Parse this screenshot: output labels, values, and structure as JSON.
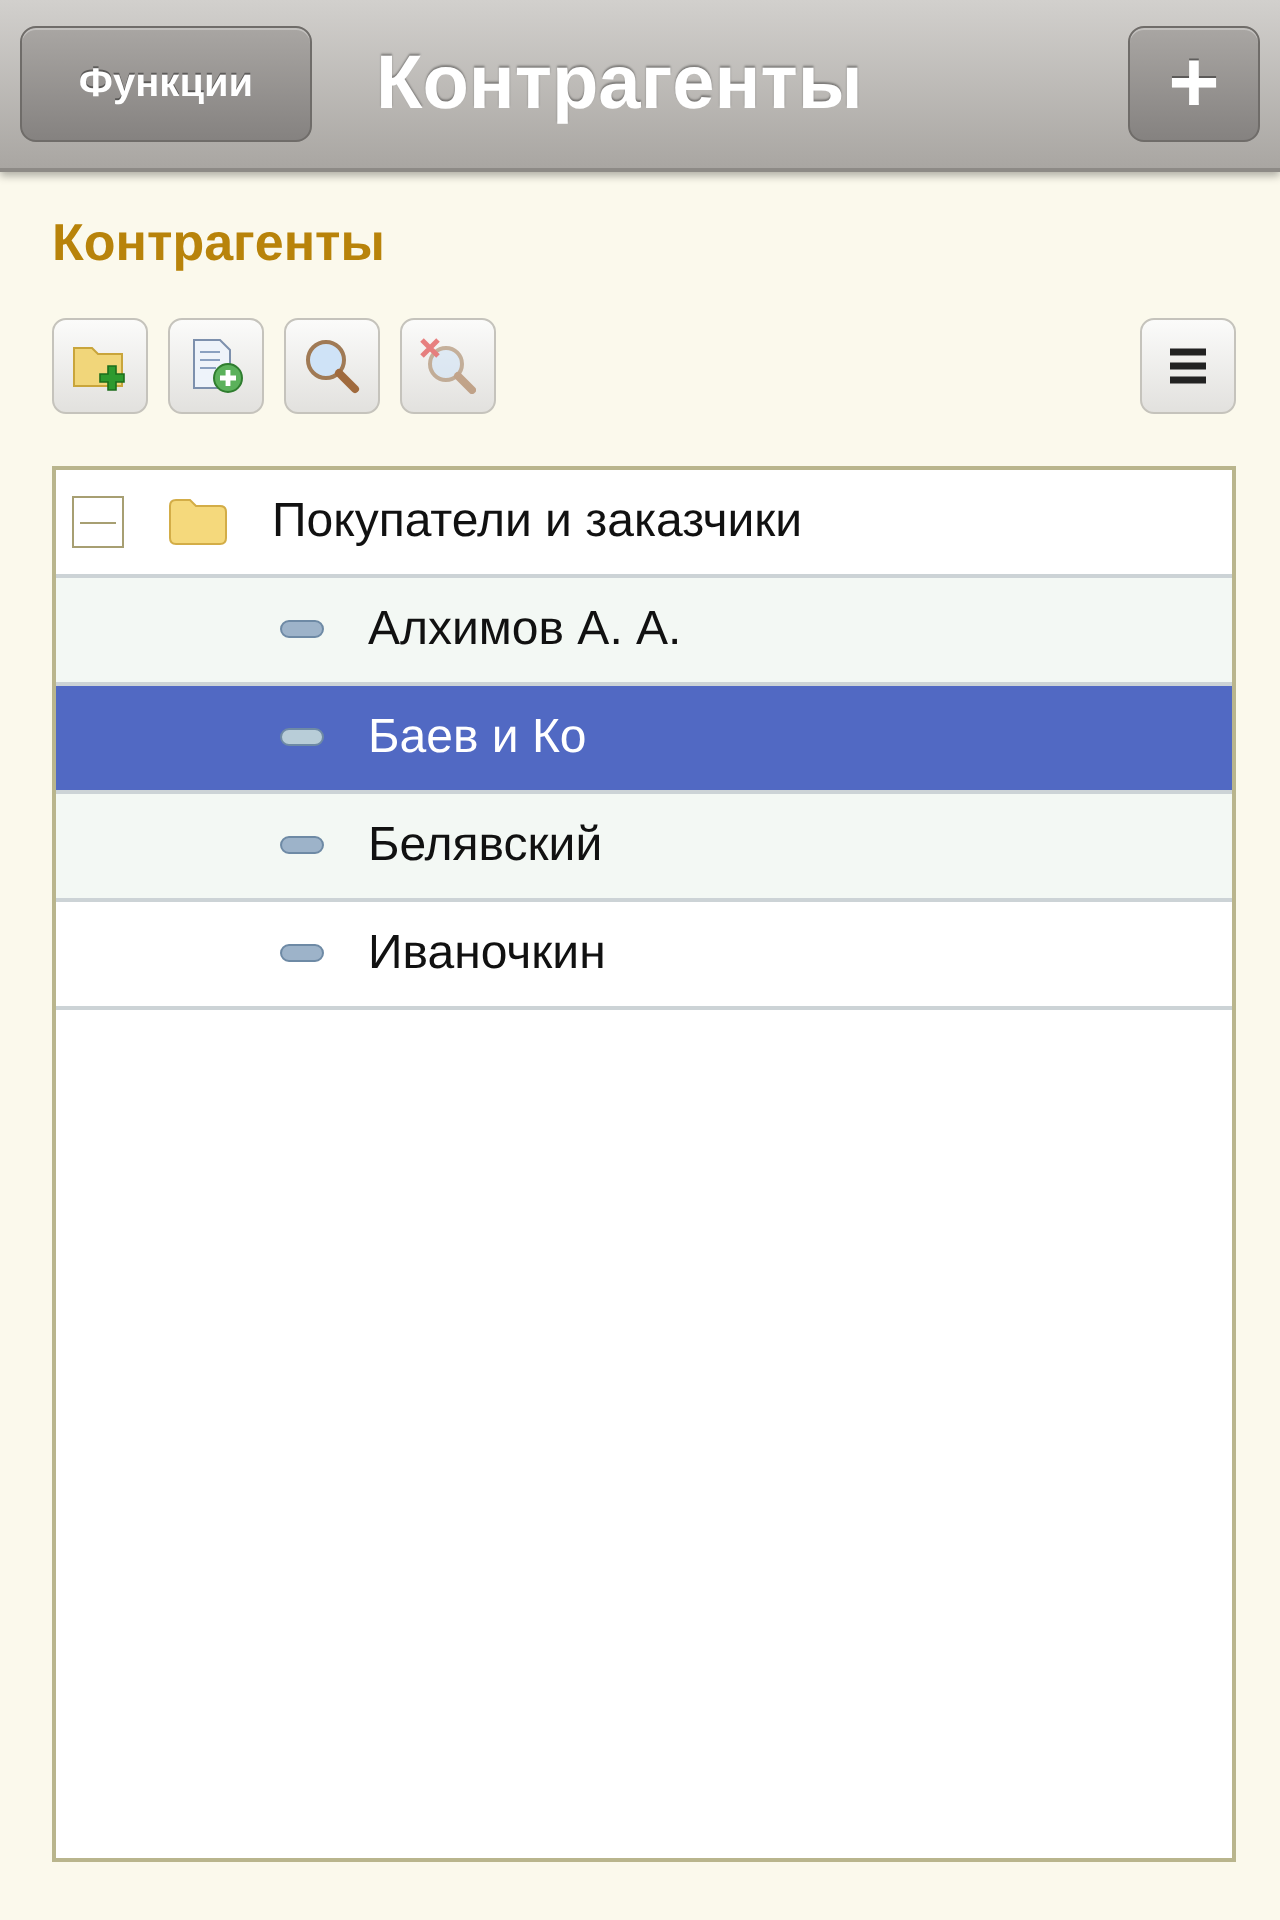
{
  "navbar": {
    "functions_button": "Функции",
    "title": "Контрагенты",
    "add_button": "+"
  },
  "section_title": "Контрагенты",
  "toolbar": [
    {
      "kind": "new-folder"
    },
    {
      "kind": "new-item"
    },
    {
      "kind": "search"
    },
    {
      "kind": "clear-search"
    },
    {
      "kind": "menu"
    }
  ],
  "tree": [
    {
      "label": "Покупатели и заказчики",
      "kind": "group",
      "expanded": true,
      "selected": false,
      "children": [
        {
          "label": "Алхимов А. А.",
          "kind": "item",
          "selected": false
        },
        {
          "label": "Баев и Ко",
          "kind": "item",
          "selected": true
        },
        {
          "label": "Белявский",
          "kind": "item",
          "selected": false
        },
        {
          "label": "Иваночкин",
          "kind": "item",
          "selected": false
        }
      ]
    }
  ]
}
